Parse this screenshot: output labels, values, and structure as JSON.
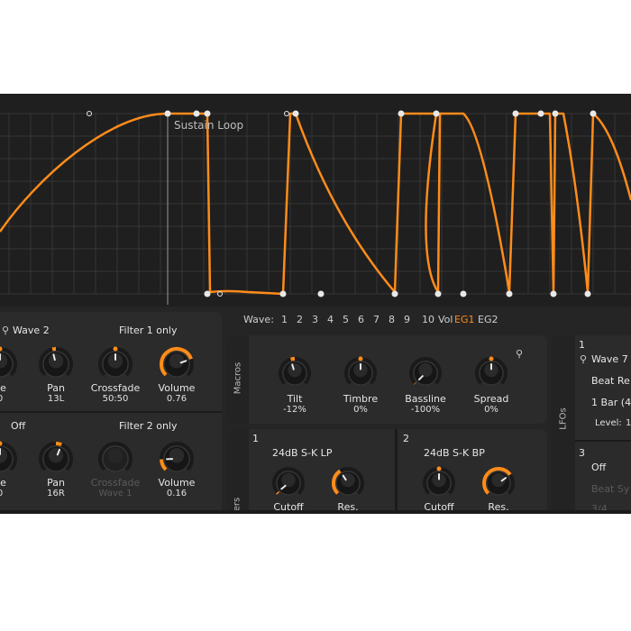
{
  "envelope": {
    "sustain_label": "Sustain Loop"
  },
  "wave_selector": {
    "label": "Wave:",
    "items": [
      "1",
      "2",
      "3",
      "4",
      "5",
      "6",
      "7",
      "8",
      "9",
      "10",
      "Vol",
      "EG1",
      "EG2"
    ],
    "active": "EG1"
  },
  "osc1": {
    "title": "Wave 2",
    "route": "Filter 1 only",
    "knobs": [
      {
        "label": "ne",
        "value": "0",
        "level": 0.5
      },
      {
        "label": "Pan",
        "value": "13L",
        "level": 0.45
      },
      {
        "label": "Crossfade",
        "value": "50:50",
        "level": 0.5
      },
      {
        "label": "Volume",
        "value": "0.76",
        "level": 0.76
      }
    ]
  },
  "osc2": {
    "title": "Off",
    "route": "Filter 2 only",
    "knobs": [
      {
        "label": "ne",
        "value": "0",
        "level": 0.5
      },
      {
        "label": "Pan",
        "value": "16R",
        "level": 0.58
      },
      {
        "label": "Crossfade",
        "value": "Wave 1",
        "level": 0.5
      },
      {
        "label": "Volume",
        "value": "0.16",
        "level": 0.16
      }
    ]
  },
  "macros": {
    "title": "Macros",
    "knobs": [
      {
        "label": "Tilt",
        "value": "-12%",
        "level": 0.44
      },
      {
        "label": "Timbre",
        "value": "0%",
        "level": 0.5
      },
      {
        "label": "Bassline",
        "value": "-100%",
        "level": 0.0
      },
      {
        "label": "Spread",
        "value": "0%",
        "level": 0.5
      }
    ]
  },
  "filters": {
    "title": "ers",
    "f1": {
      "index": "1",
      "type": "24dB S-K LP",
      "knobs": [
        {
          "label": "Cutoff",
          "level": 0.02
        },
        {
          "label": "Res.",
          "level": 0.38
        }
      ]
    },
    "f2": {
      "index": "2",
      "type": "24dB S-K BP",
      "knobs": [
        {
          "label": "Cutoff",
          "level": 0.5
        },
        {
          "label": "Res.",
          "level": 0.7
        }
      ]
    }
  },
  "lfos": {
    "title": "LFOs",
    "lfo1": {
      "index": "1",
      "wave": "Wave 7",
      "beat": "Beat Re",
      "rate": "1 Bar (4",
      "level_label": "Level:",
      "level_value": "1"
    },
    "lfo3": {
      "index": "3",
      "wave": "Off",
      "beat": "Beat Sy",
      "rate": "3/4"
    }
  },
  "colors": {
    "accent": "#ff8c1a",
    "panel": "#2b2b2b",
    "background": "#252525",
    "grid": "#363636"
  }
}
